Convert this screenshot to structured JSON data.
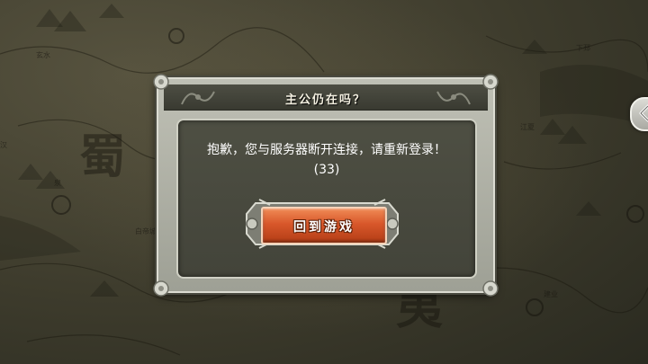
{
  "background": {
    "map_labels": [
      "玄水",
      "蜀",
      "泉",
      "汉",
      "下邳",
      "建业",
      "江夏",
      "荆州",
      "白帝城",
      "夷"
    ],
    "side_tab_icon": "chevron-left-icon"
  },
  "dialog": {
    "title": "主公仍在吗？",
    "message": "抱歉，您与服务器断开连接，请重新登录！(33)",
    "confirm_button_label": "回到游戏",
    "colors": {
      "panel_bg": "#4e4f43",
      "button": "#d8572a",
      "title_bar": "#3f4036"
    }
  }
}
